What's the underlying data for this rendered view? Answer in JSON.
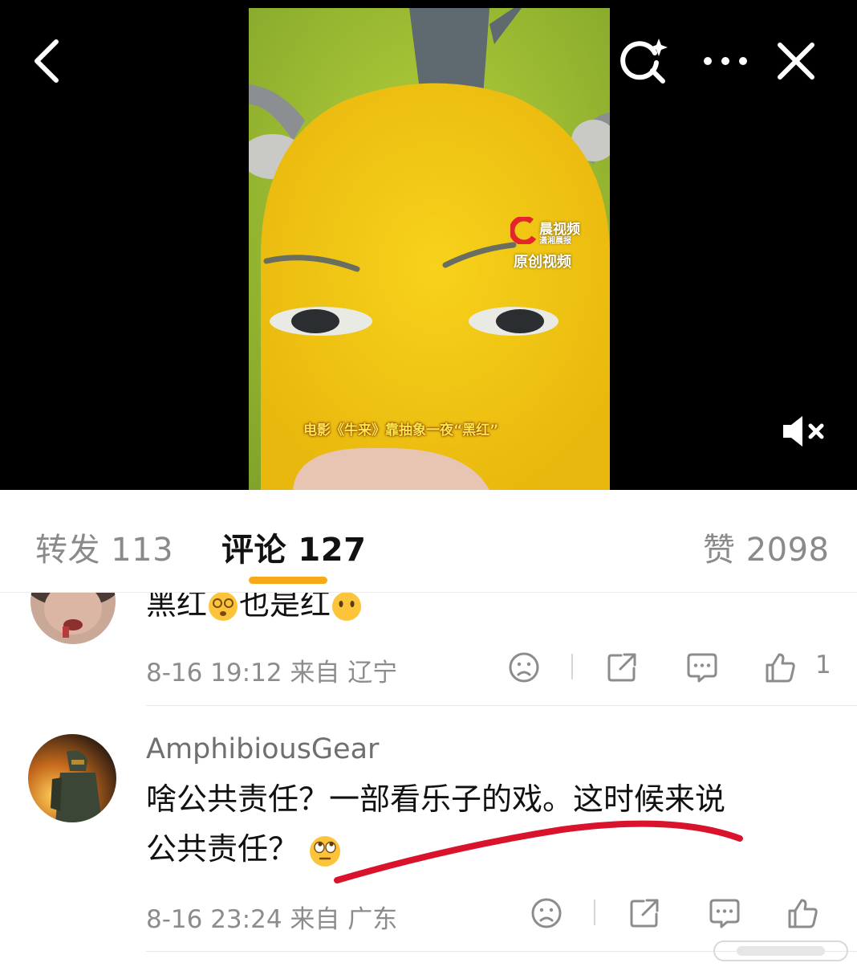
{
  "header": {
    "back_icon": "chevron-left-icon",
    "search_icon": "search-sparkle-icon",
    "more_icon": "more-dots-icon",
    "close_icon": "close-icon",
    "mute_icon": "muted-speaker-icon"
  },
  "video": {
    "watermark_name": "晨视频",
    "watermark_sub": "潇湘晨报",
    "watermark_original": "原创视频",
    "caption": "电影《牛来》靠抽象一夜“黑红”"
  },
  "tabs": {
    "repost": "转发 113",
    "comment": "评论 127",
    "like": "赞 2098",
    "accent_color": "#f8a91a"
  },
  "comments": [
    {
      "text_parts": [
        "黑红",
        "也是红"
      ],
      "time": "8-16 19:12",
      "location": "来自 辽宁",
      "like_count": "1"
    },
    {
      "username": "AmphibiousGear",
      "text_line1": "啥公共责任？一部看乐子的戏。这时候来说",
      "text_line2": "公共责任？",
      "time": "8-16 23:24",
      "location": "来自 广东"
    }
  ]
}
